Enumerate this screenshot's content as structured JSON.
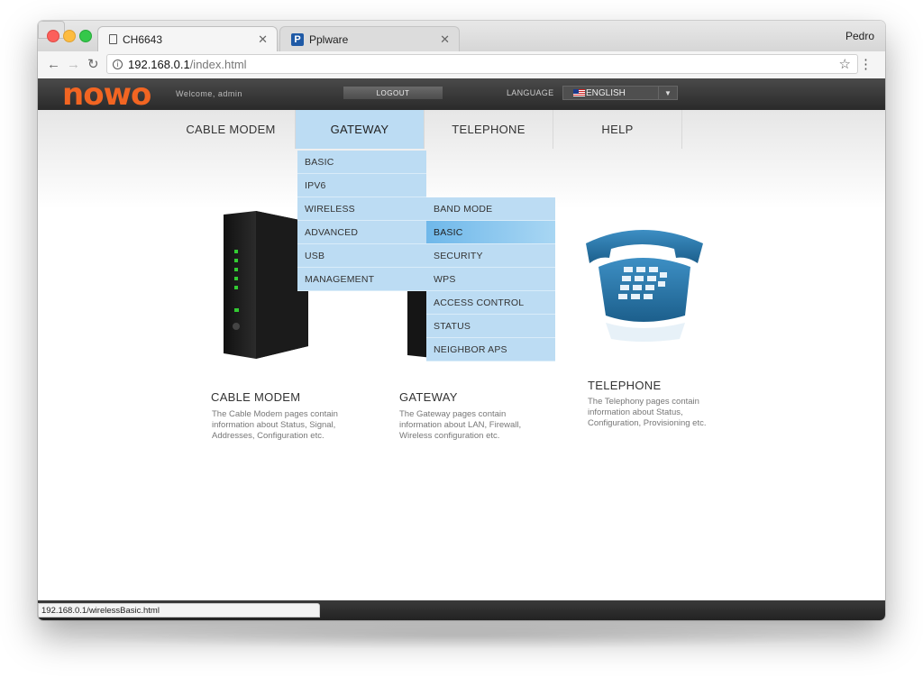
{
  "browser": {
    "tabs": [
      {
        "title": "CH6643",
        "icon": "page-icon"
      },
      {
        "title": "Pplware",
        "icon": "pplware-icon"
      }
    ],
    "profile": "Pedro",
    "url_host": "192.168.0.1",
    "url_path": "/index.html",
    "status_url": "192.168.0.1/wirelessBasic.html"
  },
  "header": {
    "logo": "nowo",
    "welcome": "Welcome, admin",
    "logout": "LOGOUT",
    "language_label": "LANGUAGE",
    "language_value": "ENGLISH"
  },
  "menu": {
    "items": [
      "CABLE MODEM",
      "GATEWAY",
      "TELEPHONE",
      "HELP"
    ],
    "active": "GATEWAY",
    "gateway_submenu": [
      "BASIC",
      "IPV6",
      "WIRELESS",
      "ADVANCED",
      "USB",
      "MANAGEMENT"
    ],
    "wireless_submenu": [
      "BAND MODE",
      "BASIC",
      "SECURITY",
      "WPS",
      "ACCESS CONTROL",
      "STATUS",
      "NEIGHBOR APS"
    ],
    "hovered": "BASIC"
  },
  "devices": [
    {
      "title": "CABLE MODEM",
      "desc": "The Cable Modem pages contain information about Status, Signal, Addresses, Configuration etc."
    },
    {
      "title": "GATEWAY",
      "desc": "The Gateway pages contain information about LAN, Firewall, Wireless configuration etc."
    },
    {
      "title": "TELEPHONE",
      "desc": "The Telephony pages contain information about Status, Configuration, Provisioning etc."
    }
  ],
  "colors": {
    "logo": "#f26522",
    "menu_active": "#bcdcf3",
    "header_bg": "#333333"
  }
}
